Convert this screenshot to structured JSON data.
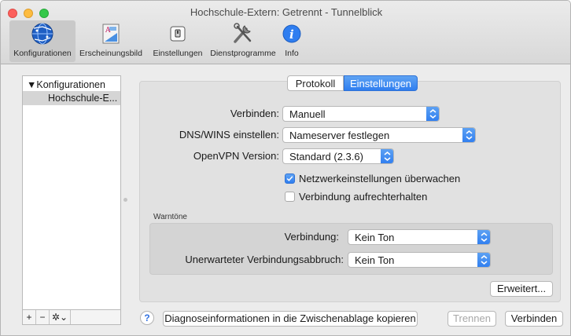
{
  "window": {
    "title": "Hochschule-Extern: Getrennt - Tunnelblick"
  },
  "toolbar": {
    "items": [
      {
        "label": "Konfigurationen",
        "icon": "globe-icon"
      },
      {
        "label": "Erscheinungsbild",
        "icon": "appearance-icon"
      },
      {
        "label": "Einstellungen",
        "icon": "switch-icon"
      },
      {
        "label": "Dienstprogramme",
        "icon": "tools-icon"
      },
      {
        "label": "Info",
        "icon": "info-icon"
      }
    ]
  },
  "sidebar": {
    "header": "▼Konfigurationen",
    "items": [
      "Hochschule-E..."
    ],
    "buttons": {
      "add": "+",
      "remove": "−",
      "gear": "✲⌄"
    }
  },
  "tabs": {
    "protokoll": "Protokoll",
    "einstellungen": "Einstellungen"
  },
  "settings": {
    "verbinden_label": "Verbinden:",
    "verbinden_value": "Manuell",
    "dns_label": "DNS/WINS einstellen:",
    "dns_value": "Nameserver festlegen",
    "openvpn_label": "OpenVPN Version:",
    "openvpn_value": "Standard (2.3.6)",
    "cb_monitor": "Netzwerkeinstellungen überwachen",
    "cb_monitor_checked": true,
    "cb_keep": "Verbindung aufrechterhalten",
    "cb_keep_checked": false
  },
  "sounds": {
    "title": "Warntöne",
    "verbindung_label": "Verbindung:",
    "verbindung_value": "Kein Ton",
    "abbruch_label": "Unerwarteter Verbindungsabbruch:",
    "abbruch_value": "Kein Ton"
  },
  "buttons": {
    "advanced": "Erweitert...",
    "help": "?",
    "diagnose": "Diagnoseinformationen in die Zwischenablage kopieren",
    "trennen": "Trennen",
    "verbinden": "Verbinden"
  },
  "colors": {
    "accent": "#2f7ef0",
    "selected_toolbar": "#c9c9c9",
    "panel": "#e1e1e1"
  }
}
